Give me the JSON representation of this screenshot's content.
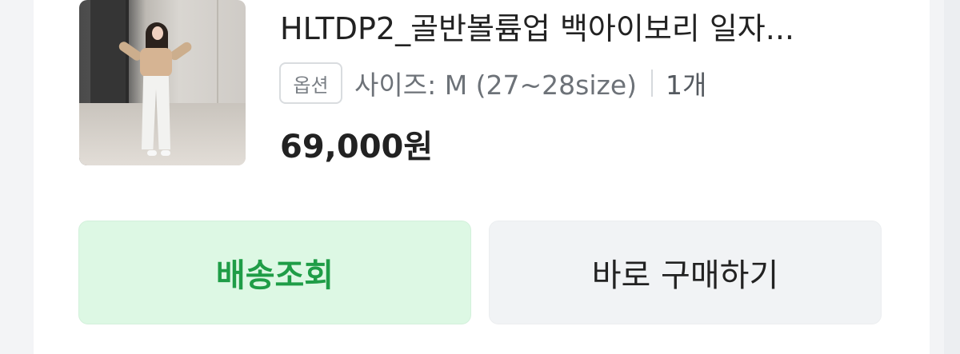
{
  "product": {
    "image_alt": "상품 이미지",
    "title": "HLTDP2_골반볼륨업 백아이보리 일자...",
    "option_badge": "옵션",
    "option_value": "사이즈: M (27~28size)",
    "quantity": "1개",
    "price": "69,000원"
  },
  "actions": {
    "track_label": "배송조회",
    "buy_label": "바로 구매하기"
  },
  "colors": {
    "track_bg": "#ddf8e4",
    "track_text": "#1f9d47",
    "buy_bg": "#f1f3f5"
  }
}
